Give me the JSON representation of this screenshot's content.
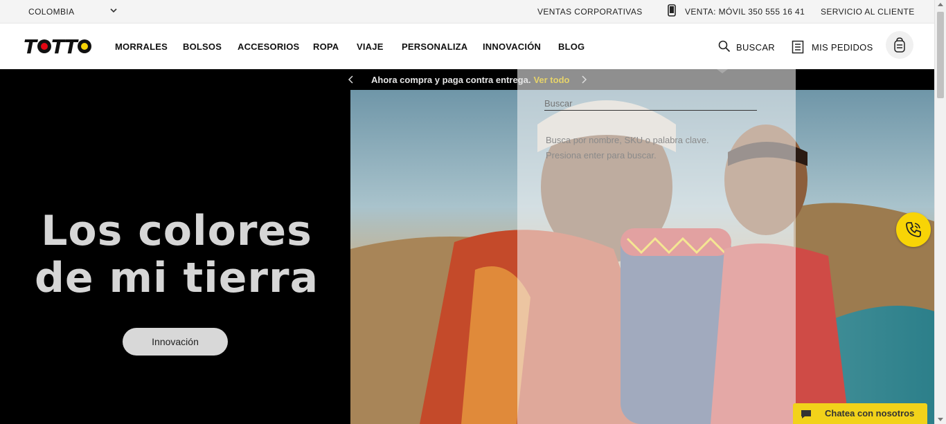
{
  "topbar": {
    "country": "COLOMBIA",
    "corporate_sales": "VENTAS CORPORATIVAS",
    "phone_sales": "VENTA: MÓVIL 350 555 16 41",
    "customer_service": "SERVICIO AL CLIENTE"
  },
  "brand": {
    "name": "TOTTO",
    "accent": "#f8d406",
    "dot_color": "#e30613"
  },
  "nav": {
    "items": [
      {
        "label": "MORRALES"
      },
      {
        "label": "BOLSOS"
      },
      {
        "label": "ACCESORIOS"
      },
      {
        "label": "ROPA"
      },
      {
        "label": "VIAJE"
      },
      {
        "label": "PERSONALIZA"
      },
      {
        "label": "INNOVACIÓN"
      },
      {
        "label": "BLOG"
      }
    ],
    "search_label": "BUSCAR",
    "orders_label": "MIS PEDIDOS"
  },
  "promo": {
    "text": "Ahora compra y paga contra entrega.",
    "link": "Ver todo"
  },
  "hero": {
    "title_line1": "Los colores",
    "title_line2": "de mi tierra",
    "button_label": "Innovación"
  },
  "search_panel": {
    "placeholder": "Buscar",
    "hint_line1": "Busca por nombre, SKU o palabra clave.",
    "hint_line2": "Presiona enter para buscar."
  },
  "chat": {
    "label": "Chatea con nosotros"
  },
  "icons": [
    "chevron-down-icon",
    "phone-icon",
    "search-icon",
    "orders-icon",
    "backpack-cart-icon",
    "chevron-left-icon",
    "chevron-right-icon",
    "call-icon",
    "chat-icon"
  ]
}
